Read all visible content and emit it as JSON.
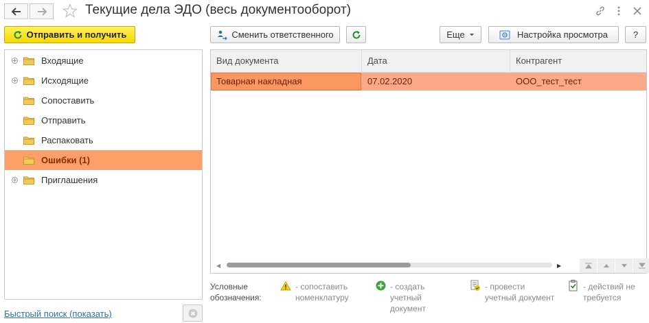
{
  "window": {
    "title": "Текущие дела ЭДО (весь документооборот)"
  },
  "toolbar": {
    "send_receive_label": "Отправить и получить",
    "change_responsible_label": "Сменить ответственного",
    "more_label": "Еще",
    "view_settings_label": "Настройка просмотра",
    "help_label": "?"
  },
  "tree": {
    "items": [
      {
        "label": "Входящие",
        "expandable": true,
        "selected": false
      },
      {
        "label": "Исходящие",
        "expandable": true,
        "selected": false
      },
      {
        "label": "Сопоставить",
        "expandable": false,
        "selected": false
      },
      {
        "label": "Отправить",
        "expandable": false,
        "selected": false
      },
      {
        "label": "Распаковать",
        "expandable": false,
        "selected": false
      },
      {
        "label": "Ошибки (1)",
        "expandable": false,
        "selected": true
      },
      {
        "label": "Приглашения",
        "expandable": true,
        "selected": false
      }
    ]
  },
  "table": {
    "columns": [
      "Вид документа",
      "Дата",
      "Контрагент"
    ],
    "rows": [
      [
        "Товарная накладная",
        "07.02.2020",
        "ООО_тест_тест"
      ]
    ]
  },
  "legend": {
    "title_line1": "Условные",
    "title_line2": "обозначения:",
    "items": [
      {
        "icon": "warning-icon",
        "line1": "- сопоставить",
        "line2": "номенклатуру",
        "line3": ""
      },
      {
        "icon": "plus-circle-icon",
        "line1": "- создать",
        "line2": "учетный",
        "line3": "документ"
      },
      {
        "icon": "post-document-icon",
        "line1": "- провести",
        "line2": "учетный документ",
        "line3": ""
      },
      {
        "icon": "clipboard-check-icon",
        "line1": "- действий не",
        "line2": "требуется",
        "line3": ""
      }
    ]
  },
  "footer": {
    "quick_search_label": "Быстрый поиск (показать)"
  },
  "colors": {
    "accent_yellow": "#f4d800",
    "selected_row": "#fca06a",
    "table_row": "#fca98a",
    "link": "#2b6fb6"
  }
}
